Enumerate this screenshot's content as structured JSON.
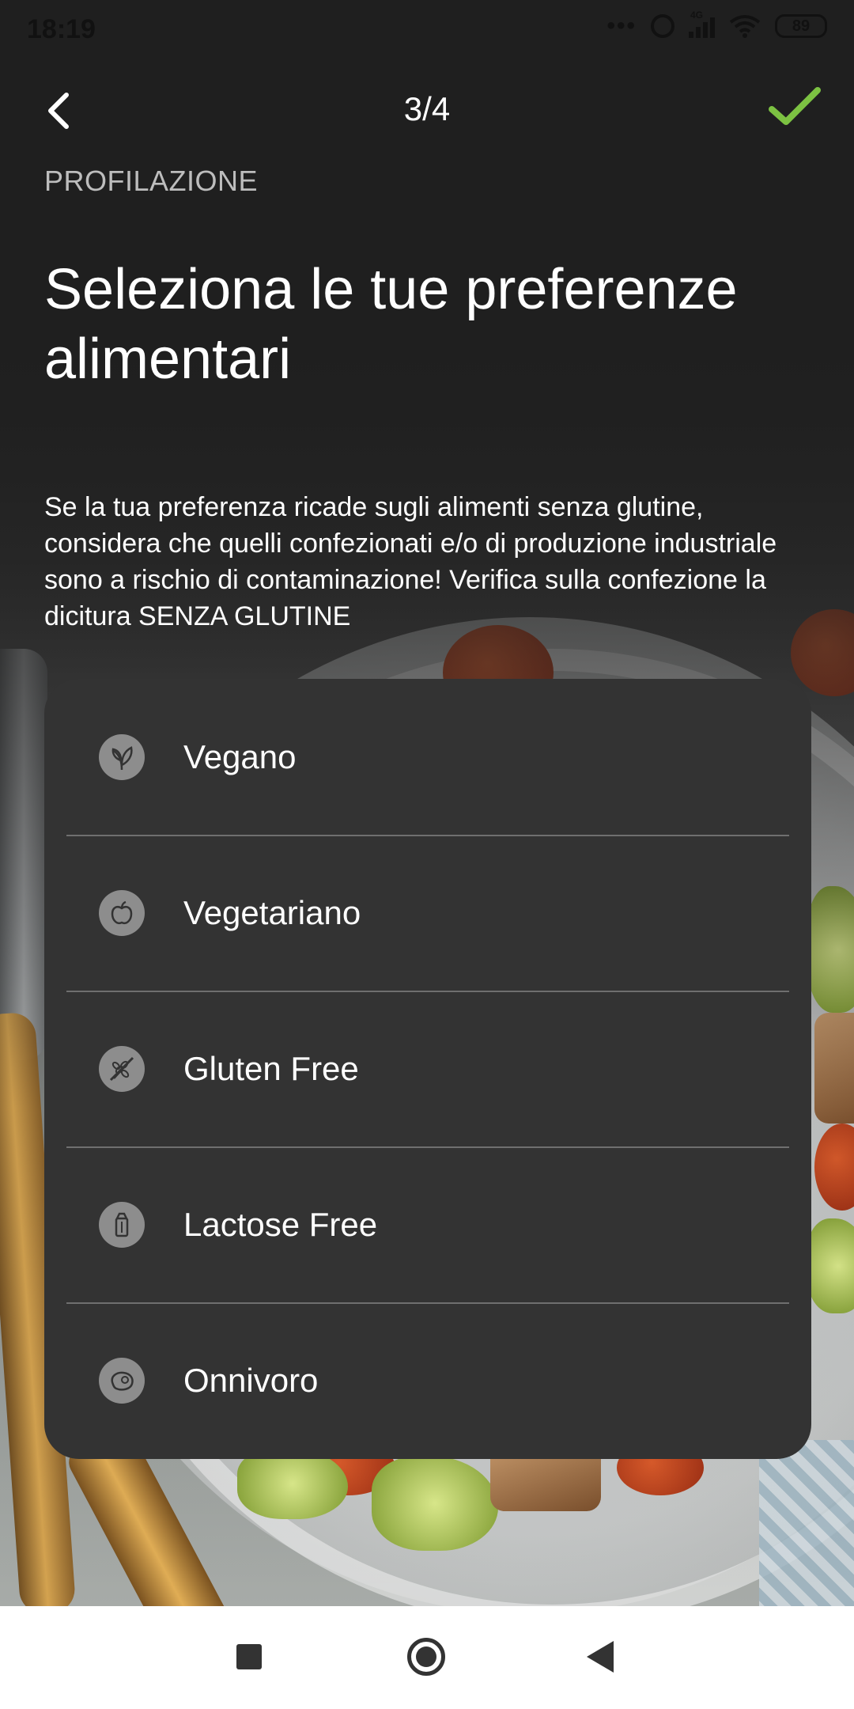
{
  "status_bar": {
    "time": "18:19",
    "network": "4G",
    "battery": "89"
  },
  "header": {
    "step": "3/4",
    "back_icon": "chevron-left-icon",
    "confirm_icon": "check-icon",
    "confirm_color": "#7cc242"
  },
  "section_label": "PROFILAZIONE",
  "title": "Seleziona le tue preferenze alimentari",
  "description": "Se la tua preferenza ricade sugli alimenti senza glutine, considera che quelli confezionati e/o di produzione industriale sono a rischio di contaminazione! Verifica sulla confezione la dicitura SENZA GLUTINE",
  "options": [
    {
      "label": "Vegano",
      "icon": "leaf-icon"
    },
    {
      "label": "Vegetariano",
      "icon": "apple-icon"
    },
    {
      "label": "Gluten Free",
      "icon": "wheat-crossed-icon"
    },
    {
      "label": "Lactose Free",
      "icon": "milk-carton-icon"
    },
    {
      "label": "Onnivoro",
      "icon": "steak-icon"
    }
  ],
  "nav_bar": {
    "recents_icon": "square-icon",
    "home_icon": "circle-icon",
    "back_icon": "triangle-back-icon"
  }
}
